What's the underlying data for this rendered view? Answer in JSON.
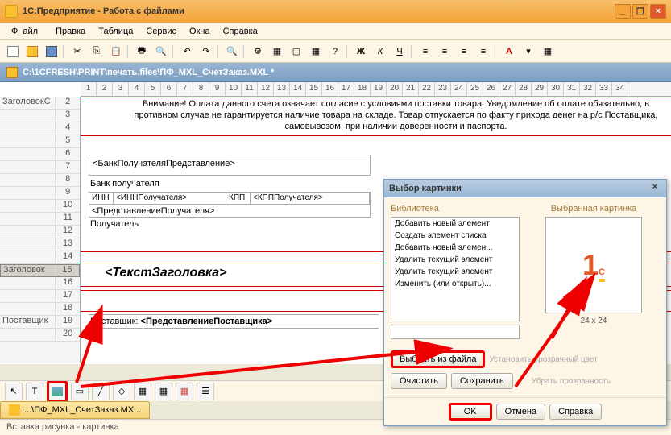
{
  "window": {
    "title": "1С:Предприятие - Работа с файлами"
  },
  "menu": {
    "file": "Файл",
    "edit": "Правка",
    "table": "Таблица",
    "service": "Сервис",
    "windows": "Окна",
    "help": "Справка"
  },
  "doc": {
    "path": "C:\\1CFRESH\\PRINT\\печать.files\\ПФ_MXL_СчетЗаказ.MXL *"
  },
  "ruler": [
    "1",
    "2",
    "3",
    "4",
    "5",
    "6",
    "7",
    "8",
    "9",
    "10",
    "11",
    "12",
    "13",
    "14",
    "15",
    "16",
    "17",
    "18",
    "19",
    "20",
    "21",
    "22",
    "23",
    "24",
    "25",
    "26",
    "27",
    "28",
    "29",
    "30",
    "31",
    "32",
    "33",
    "34"
  ],
  "rows": {
    "labels": [
      "ЗаголовокС",
      "",
      "",
      "",
      "",
      "",
      "",
      "",
      "",
      "",
      "",
      "",
      "",
      "Заголовок",
      "",
      "",
      "",
      "Поставщик",
      ""
    ],
    "nums": [
      "2",
      "3",
      "4",
      "5",
      "6",
      "7",
      "8",
      "9",
      "10",
      "11",
      "12",
      "13",
      "14",
      "15",
      "16",
      "17",
      "18",
      "19",
      "20"
    ]
  },
  "warning": "Внимание! Оплата данного счета означает согласие с условиями поставки товара. Уведомление об оплате обязательно, в противном случае не гарантируется наличие товара на складе. Товар отпускается по факту прихода денег на р/с Поставщика, самовывозом, при наличии доверенности и паспорта.",
  "cells": {
    "bank_repr": "<БанкПолучателяПредставление>",
    "bank_lbl": "Банк получателя",
    "inn_lbl": "ИНН",
    "inn_val": "<ИННПолучателя>",
    "kpp_lbl": "КПП",
    "kpp_val": "<КПППолучателя>",
    "pred": "<ПредставлениеПолучателя>",
    "recipient_lbl": "Получатель",
    "title_text": "<ТекстЗаголовка>",
    "supplier_lbl": "Поставщик:",
    "supplier_val": "<ПредставлениеПоставщика>"
  },
  "dialog": {
    "title": "Выбор картинки",
    "lib_lbl": "Библиотека",
    "sel_lbl": "Выбранная картинка",
    "list": [
      "Добавить новый элемент",
      "Создать элемент списка",
      "Добавить новый элемен...",
      "Удалить текущий элемент",
      "Удалить текущий элемент",
      "Изменить (или открыть)..."
    ],
    "dims": "24 x 24",
    "btn_file": "Выбрать из файла",
    "btn_clear": "Очистить",
    "btn_save": "Сохранить",
    "btn_transp": "Установить прозрачный цвет",
    "btn_rmtransp": "Убрать прозрачность",
    "btn_ok": "OK",
    "btn_cancel": "Отмена",
    "btn_help": "Справка"
  },
  "taskbar": {
    "tab": "...\\ПФ_MXL_СчетЗаказ.MX..."
  },
  "status": {
    "text": "Вставка рисунка - картинка"
  }
}
